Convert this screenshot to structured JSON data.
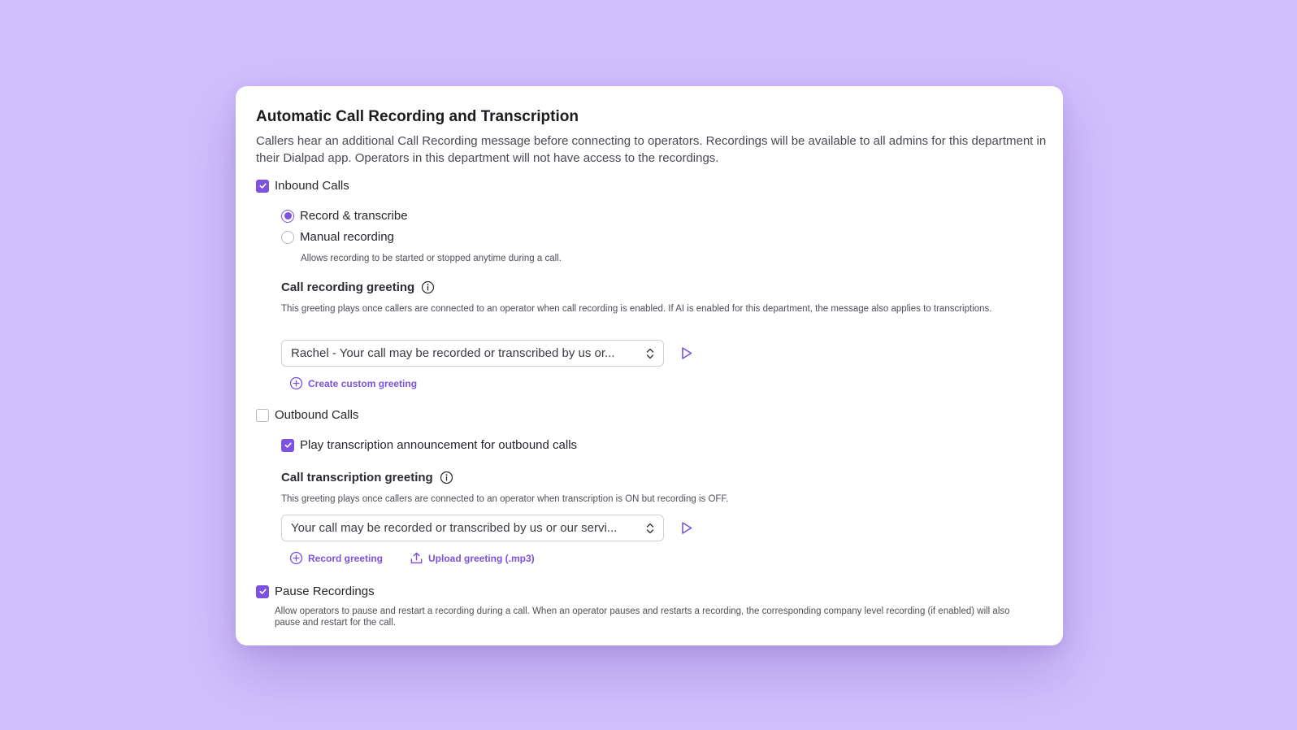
{
  "header": {
    "title": "Automatic Call Recording and Transcription",
    "description": "Callers hear an additional Call Recording message before connecting to operators. Recordings will be available to all admins for this department in their Dialpad app. Operators in this department will not have access to the recordings."
  },
  "inbound": {
    "label": "Inbound Calls",
    "checked": true,
    "options": [
      {
        "label": "Record & transcribe",
        "selected": true
      },
      {
        "label": "Manual recording",
        "selected": false
      }
    ],
    "manual_hint": "Allows recording to be started or stopped anytime during a call.",
    "greeting": {
      "heading": "Call recording greeting",
      "description": "This greeting plays once callers are connected to an operator when call recording is enabled. If AI is enabled for this department, the message also applies to transcriptions.",
      "selected_value": "Rachel - Your call may be recorded or transcribed by us or...",
      "create_link": "Create custom greeting"
    }
  },
  "outbound": {
    "label": "Outbound Calls",
    "checked": false,
    "announcement_label": "Play transcription announcement for outbound calls",
    "announcement_checked": true,
    "greeting": {
      "heading": "Call transcription greeting",
      "description": "This greeting plays once callers are connected to an operator when transcription is ON but recording is OFF.",
      "selected_value": "Your call may be recorded or transcribed by us or our servi...",
      "record_link": "Record greeting",
      "upload_link": "Upload greeting (.mp3)"
    }
  },
  "pause": {
    "label": "Pause Recordings",
    "checked": true,
    "description": "Allow operators to pause and restart a recording during a call. When an operator pauses and restarts a recording, the corresponding company level recording (if enabled) will also pause and restart for the call."
  },
  "colors": {
    "background": "#d1bffd",
    "accent": "#7c52e0",
    "card": "#ffffff"
  },
  "icons": [
    "check-icon",
    "info-icon",
    "chevron-updown-icon",
    "play-icon",
    "plus-circle-icon",
    "upload-icon"
  ]
}
